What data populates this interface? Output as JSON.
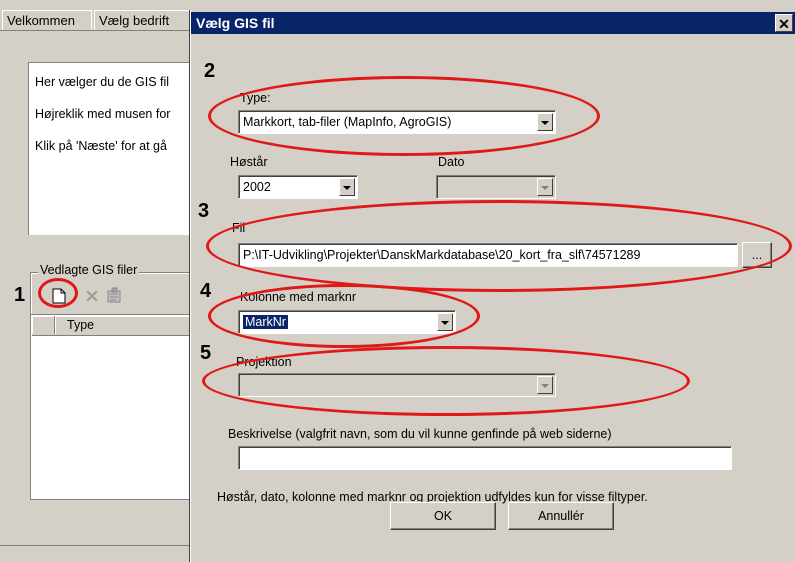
{
  "background": {
    "tabs": [
      "Velkommen",
      "Vælg bedrift"
    ],
    "info_lines": [
      "Her vælger du de GIS fil",
      "Højreklik med musen for",
      "Klik på 'Næste' for at gå"
    ],
    "group_label": "Vedlagte GIS filer",
    "list_columns": [
      "",
      "Type"
    ]
  },
  "dialog": {
    "title": "Vælg GIS fil",
    "close": "✕",
    "type_label": "Type:",
    "type_value": "Markkort, tab-filer (MapInfo, AgroGIS)",
    "year_label": "Høstår",
    "year_value": "2002",
    "date_label": "Dato",
    "file_label": "Fil",
    "file_value": "P:\\IT-Udvikling\\Projekter\\DanskMarkdatabase\\20_kort_fra_slf\\74571289",
    "browse_label": "...",
    "column_label": "Kolonne med marknr",
    "column_value": "MarkNr",
    "projection_label": "Projektion",
    "description_label": "Beskrivelse (valgfrit navn, som du vil kunne genfinde på web siderne)",
    "description_value": "",
    "note": "Høstår, dato, kolonne med marknr og projektion udfyldes kun for visse filtyper.",
    "ok_label": "OK",
    "cancel_label": "Annullér"
  },
  "annotations": {
    "numbers": [
      "1",
      "2",
      "3",
      "4",
      "5"
    ],
    "color": "#e01818"
  },
  "icons": [
    "new-file-icon",
    "delete-icon",
    "properties-icon",
    "chevron-down-icon"
  ]
}
